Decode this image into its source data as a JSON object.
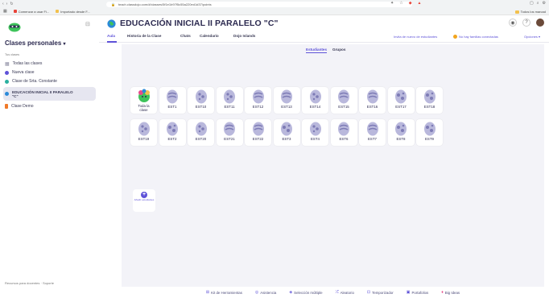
{
  "browser": {
    "url": "teach.classdojo.com/#/classes/5f1e1b97f5c55a220ed1d37/points",
    "bookmarks": [
      "Comenzar a usar Fi...",
      "Importado desde F..."
    ],
    "bookmarks_right": "Todos los marcad"
  },
  "sidebar": {
    "title": "Clases personales",
    "title_caret": "▾",
    "subtitle": "Tus clases",
    "items": [
      {
        "label": "Todas las clases",
        "color": "#8a8aa0"
      },
      {
        "label": "Nueva clase",
        "color": "#5e52d8"
      },
      {
        "label": "Clase de Srta. Constante",
        "color": "#2ab0a0"
      },
      {
        "label": "EDUCACIÓN INICIAL II PARALELO \"C\"",
        "color": "#2b8ad8"
      },
      {
        "label": "Clase Demo",
        "color": "#f07a2a"
      }
    ],
    "footer_links": [
      "Recursos para docentes",
      "Soporte"
    ]
  },
  "header": {
    "title": "EDUCACIÓN INICIAL II PARALELO \"C\""
  },
  "tabs": [
    "Aula",
    "Historia de la Clase",
    "Chats",
    "Calendario",
    "Dojo Islands"
  ],
  "tabs_right": {
    "connect": "Invita de nuevo de estudiantes",
    "families": "No hay familias conectadas",
    "options": "Opciones ▾"
  },
  "subtabs": [
    "Estudiantes",
    "Grupos"
  ],
  "students": [
    {
      "label": "Toda la clase",
      "kind": "class"
    },
    {
      "label": "EST1",
      "kind": "egg"
    },
    {
      "label": "EST10",
      "kind": "egg2"
    },
    {
      "label": "EST11",
      "kind": "egg2"
    },
    {
      "label": "EST12",
      "kind": "egg"
    },
    {
      "label": "EST13",
      "kind": "egg"
    },
    {
      "label": "EST14",
      "kind": "egg2"
    },
    {
      "label": "EST15",
      "kind": "egg"
    },
    {
      "label": "EST16",
      "kind": "egg"
    },
    {
      "label": "EST17",
      "kind": "egg3"
    },
    {
      "label": "EST18",
      "kind": "egg3"
    },
    {
      "label": "EST19",
      "kind": "egg2"
    },
    {
      "label": "EST2",
      "kind": "egg3"
    },
    {
      "label": "EST20",
      "kind": "egg2"
    },
    {
      "label": "EST21",
      "kind": "egg"
    },
    {
      "label": "EST22",
      "kind": "egg"
    },
    {
      "label": "EST3",
      "kind": "egg3"
    },
    {
      "label": "EST4",
      "kind": "egg2"
    },
    {
      "label": "EST6",
      "kind": "egg"
    },
    {
      "label": "EST7",
      "kind": "egg"
    },
    {
      "label": "EST8",
      "kind": "egg3"
    },
    {
      "label": "EST9",
      "kind": "egg3"
    }
  ],
  "add_student": "Añadir estudiantes",
  "toolbar": [
    {
      "label": "Kit de Herramientas",
      "icon": "grid-icon"
    },
    {
      "label": "Asistencia",
      "icon": "check-circle-icon"
    },
    {
      "label": "Selección múltiple",
      "icon": "multi-select-icon"
    },
    {
      "label": "Aleatorio",
      "icon": "shuffle-icon"
    },
    {
      "label": "Temporizador",
      "icon": "timer-icon"
    },
    {
      "label": "Portafolios",
      "icon": "portfolio-icon"
    },
    {
      "label": "Big Ideas",
      "icon": "lightbulb-icon"
    }
  ],
  "colors": {
    "accent": "#5e52d8",
    "egg": "#b9b8dc",
    "egg_dark": "#7d7bb5"
  }
}
